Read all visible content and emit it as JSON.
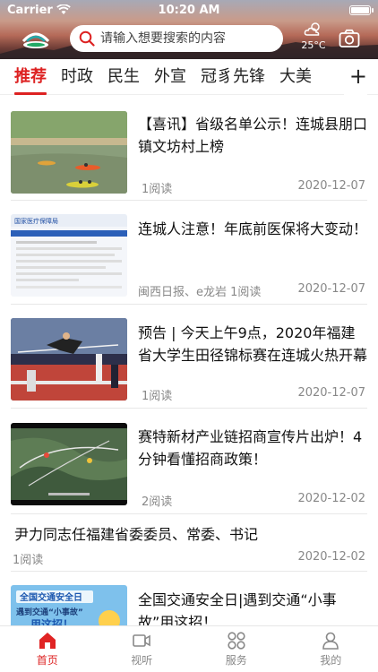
{
  "status": {
    "carrier": "Carrier",
    "time": "10:20 AM"
  },
  "header": {
    "search_placeholder": "请输入想要搜索的内容",
    "weather_temp": "25°C"
  },
  "tabs": [
    {
      "label": "推荐",
      "active": true
    },
    {
      "label": "时政"
    },
    {
      "label": "民生"
    },
    {
      "label": "外宣"
    },
    {
      "label": "冠豸先锋"
    },
    {
      "label": "大美"
    }
  ],
  "tab_more": "+",
  "feed": [
    {
      "title": "【喜讯】省级名单公示！连城县朋口镇文坊村上榜",
      "meta": "1阅读",
      "date": "2020-12-07"
    },
    {
      "title": "连城人注意！年底前医保将大变动！",
      "meta": "闽西日报、e龙岩  1阅读",
      "date": "2020-12-07"
    },
    {
      "title": "预告 | 今天上午9点，2020年福建省大学生田径锦标赛在连城火热开幕",
      "meta": "1阅读",
      "date": "2020-12-07"
    },
    {
      "title": "赛特新材产业链招商宣传片出炉！4分钟看懂招商政策！",
      "meta": "2阅读",
      "date": "2020-12-02"
    },
    {
      "title": "尹力同志任福建省委委员、常委、书记",
      "meta": "1阅读",
      "date": "2020-12-02"
    },
    {
      "title": "全国交通安全日|遇到交通“小事故”用这招！",
      "meta": "",
      "date": ""
    }
  ],
  "thumb_text": {
    "medical_header": "国家医疗保障局",
    "traffic_line1": "全国交通安全日",
    "traffic_line2": "遇到交通“小事故”",
    "traffic_line3": "用这招！"
  },
  "bottom_nav": [
    {
      "label": "首页",
      "icon": "home-icon",
      "active": true
    },
    {
      "label": "视听",
      "icon": "video-icon"
    },
    {
      "label": "服务",
      "icon": "grid-icon"
    },
    {
      "label": "我的",
      "icon": "user-icon"
    }
  ],
  "colors": {
    "accent": "#dd2222",
    "text": "#222222",
    "muted": "#888888"
  }
}
